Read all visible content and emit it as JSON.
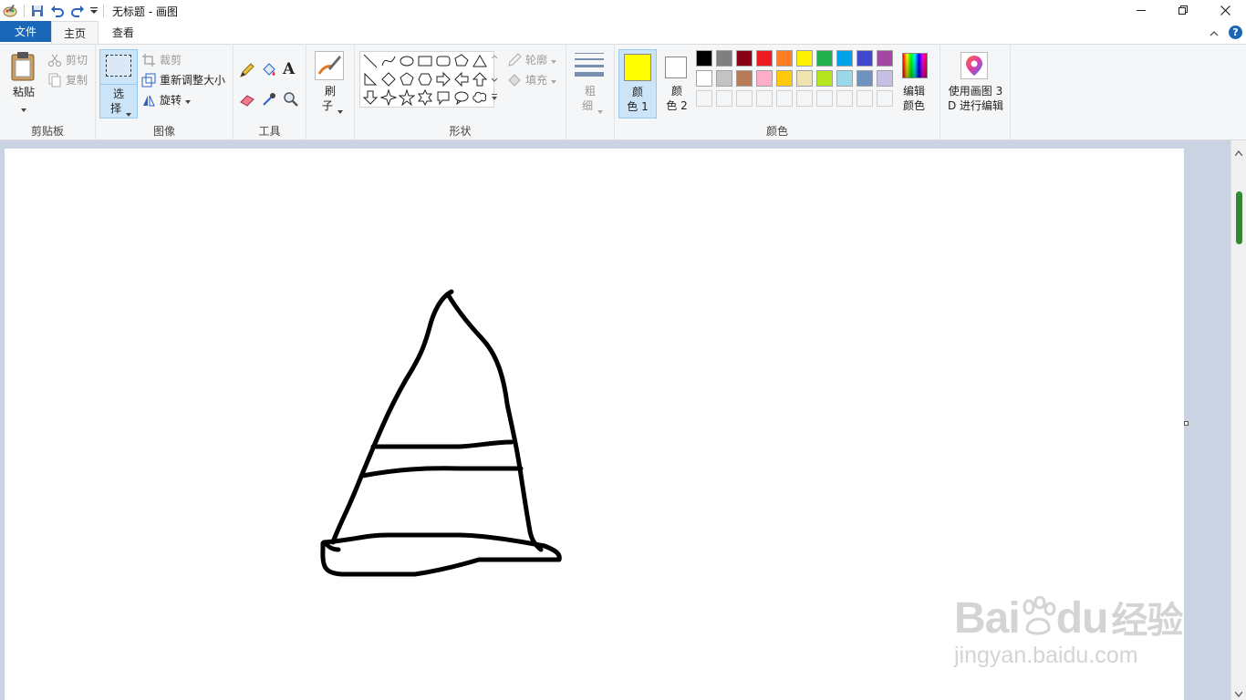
{
  "window": {
    "title": "无标题 - 画图"
  },
  "tabs": {
    "file": "文件",
    "home": "主页",
    "view": "查看"
  },
  "clipboard": {
    "paste": "粘贴",
    "cut": "剪切",
    "copy": "复制",
    "group_label": "剪贴板"
  },
  "image": {
    "select_line1": "选",
    "select_line2": "择",
    "crop": "裁剪",
    "resize": "重新调整大小",
    "rotate": "旋转",
    "group_label": "图像"
  },
  "tools": {
    "group_label": "工具"
  },
  "brushes": {
    "line1": "刷",
    "line2": "子"
  },
  "shapes": {
    "outline": "轮廓",
    "fill": "填充",
    "group_label": "形状"
  },
  "size": {
    "line1": "粗",
    "line2": "细"
  },
  "colors": {
    "color1_line1": "颜",
    "color1_line2": "色 1",
    "color2_line1": "颜",
    "color2_line2": "色 2",
    "edit_line1": "编辑",
    "edit_line2": "颜色",
    "group_label": "颜色",
    "color1_value": "#ffff00",
    "color2_value": "#ffffff",
    "palette_row1": [
      "#000000",
      "#7f7f7f",
      "#880015",
      "#ed1c24",
      "#ff7f27",
      "#fff200",
      "#22b14c",
      "#00a2e8",
      "#3f48cc",
      "#a349a4"
    ],
    "palette_row2": [
      "#ffffff",
      "#c3c3c3",
      "#b97a57",
      "#ffaec9",
      "#ffc90e",
      "#efe4b0",
      "#b5e61d",
      "#99d9ea",
      "#7092be",
      "#c8bfe7"
    ]
  },
  "paint3d": {
    "line1": "使用画图 3",
    "line2": "D 进行编辑"
  },
  "watermark": {
    "brand": "Bai",
    "brand2": "du",
    "brand_cn": "经验",
    "url": "jingyan.baidu.com"
  }
}
